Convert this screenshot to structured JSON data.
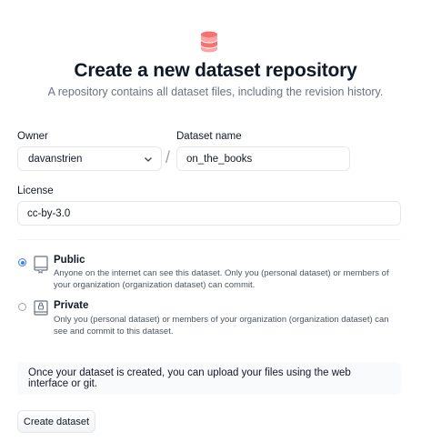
{
  "header": {
    "icon": "database-icon",
    "accent_color": "#ef4444",
    "title": "Create a new dataset repository",
    "subtitle": "A repository contains all dataset files, including the revision history."
  },
  "form": {
    "owner": {
      "label": "Owner",
      "value": "davanstrien"
    },
    "separator": "/",
    "dataset_name": {
      "label": "Dataset name",
      "value": "on_the_books"
    },
    "license": {
      "label": "License",
      "value": "cc-by-3.0"
    },
    "visibility": {
      "selected": "public",
      "options": [
        {
          "id": "public",
          "icon": "book-icon",
          "title": "Public",
          "description": "Anyone on the internet can see this dataset. Only you (personal dataset) or members of your organization (organization dataset) can commit."
        },
        {
          "id": "private",
          "icon": "lock-book-icon",
          "title": "Private",
          "description": "Only you (personal dataset) or members of your organization (organization dataset) can see and commit to this dataset."
        }
      ]
    },
    "info": "Once your dataset is created, you can upload your files using the web interface or git.",
    "submit_label": "Create dataset"
  }
}
